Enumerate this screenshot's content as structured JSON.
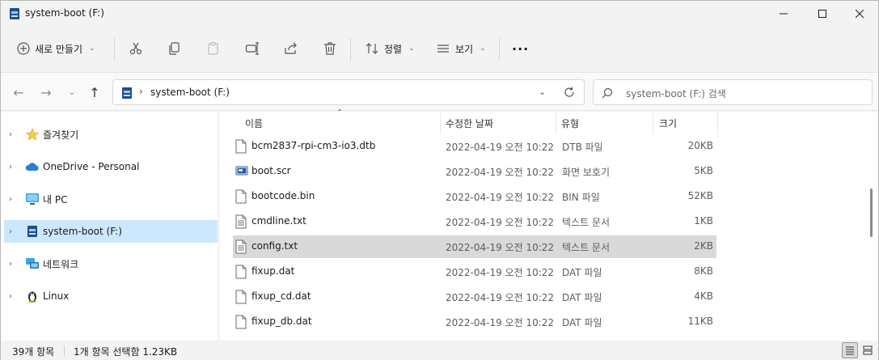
{
  "window": {
    "title": "system-boot (F:)"
  },
  "toolbar": {
    "new_label": "새로 만들기",
    "sort_label": "정렬",
    "view_label": "보기",
    "more_label": "···"
  },
  "address": {
    "path": "system-boot (F:)",
    "search_placeholder": "system-boot (F:) 검색"
  },
  "sidebar": {
    "items": [
      {
        "label": "즐겨찾기",
        "icon": "star-icon"
      },
      {
        "label": "OneDrive - Personal",
        "icon": "cloud-icon"
      },
      {
        "label": "내 PC",
        "icon": "monitor-icon"
      },
      {
        "label": "system-boot (F:)",
        "icon": "drive-icon",
        "selected": true
      },
      {
        "label": "네트워크",
        "icon": "network-icon"
      },
      {
        "label": "Linux",
        "icon": "penguin-icon"
      }
    ]
  },
  "columns": {
    "name": "이름",
    "date": "수정한 날짜",
    "type": "유형",
    "size": "크기"
  },
  "files": [
    {
      "name": "bcm2837-rpi-cm3-io3.dtb",
      "date": "2022-04-19 오전 10:22",
      "type": "DTB 파일",
      "size": "20KB",
      "icon": "file-icon"
    },
    {
      "name": "boot.scr",
      "date": "2022-04-19 오전 10:22",
      "type": "화면 보호기",
      "size": "5KB",
      "icon": "screensaver-icon"
    },
    {
      "name": "bootcode.bin",
      "date": "2022-04-19 오전 10:22",
      "type": "BIN 파일",
      "size": "52KB",
      "icon": "file-icon"
    },
    {
      "name": "cmdline.txt",
      "date": "2022-04-19 오전 10:22",
      "type": "텍스트 문서",
      "size": "1KB",
      "icon": "text-file-icon"
    },
    {
      "name": "config.txt",
      "date": "2022-04-19 오전 10:22",
      "type": "텍스트 문서",
      "size": "2KB",
      "icon": "text-file-icon",
      "selected": true
    },
    {
      "name": "fixup.dat",
      "date": "2022-04-19 오전 10:22",
      "type": "DAT 파일",
      "size": "8KB",
      "icon": "file-icon"
    },
    {
      "name": "fixup_cd.dat",
      "date": "2022-04-19 오전 10:22",
      "type": "DAT 파일",
      "size": "4KB",
      "icon": "file-icon"
    },
    {
      "name": "fixup_db.dat",
      "date": "2022-04-19 오전 10:22",
      "type": "DAT 파일",
      "size": "11KB",
      "icon": "file-icon"
    }
  ],
  "status": {
    "item_count": "39개 항목",
    "selection": "1개 항목 선택함 1.23KB"
  },
  "colors": {
    "selected_nav": "#cce8ff",
    "selected_row": "#d9d9d9",
    "accent": "#0067c0"
  }
}
